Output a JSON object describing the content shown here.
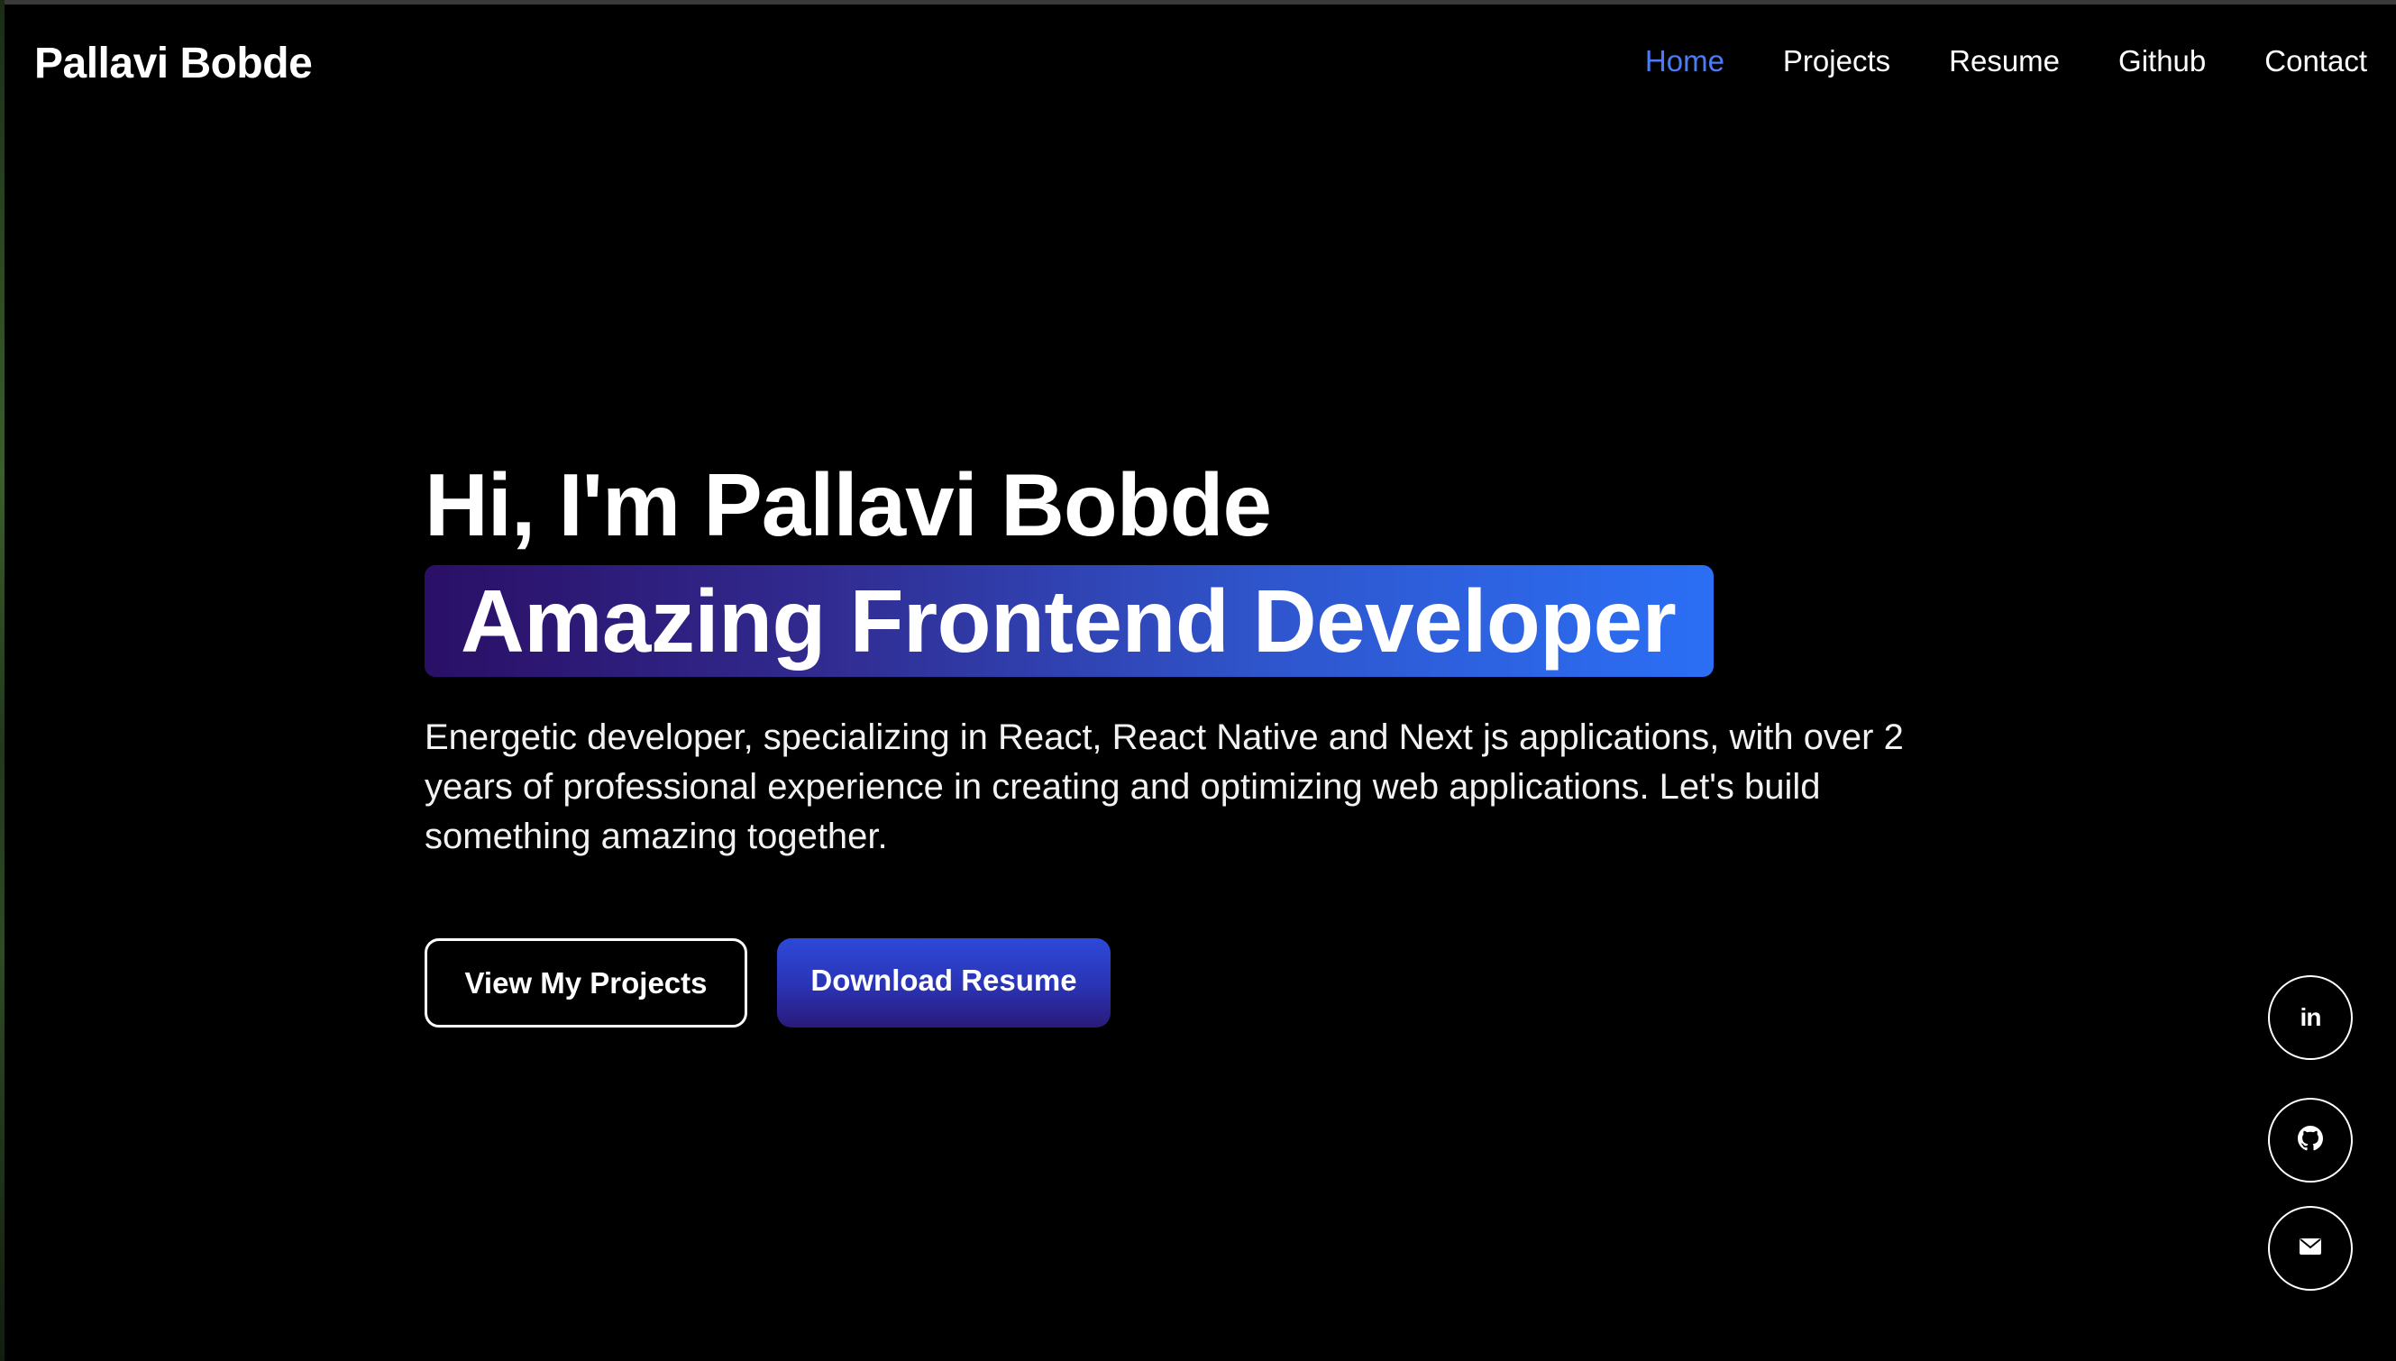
{
  "nav": {
    "brand": "Pallavi Bobde",
    "items": [
      {
        "label": "Home",
        "active": true
      },
      {
        "label": "Projects",
        "active": false
      },
      {
        "label": "Resume",
        "active": false
      },
      {
        "label": "Github",
        "active": false
      },
      {
        "label": "Contact",
        "active": false
      }
    ],
    "active_color": "#4b7bf5"
  },
  "hero": {
    "greeting": "Hi, I'm Pallavi Bobde",
    "role": "Amazing Frontend Developer",
    "description": "Energetic developer, specializing in React, React Native and Next js applications, with over 2 years of professional experience in creating and optimizing web applications. Let's build something amazing together.",
    "primary_cta": "View My Projects",
    "secondary_cta": "Download Resume"
  },
  "social": {
    "linkedin_label": "in",
    "items": [
      "linkedin-icon",
      "github-icon",
      "mail-icon"
    ]
  },
  "colors": {
    "background": "#000000",
    "text": "#ffffff",
    "accent_blue": "#2b6ff5",
    "accent_purple": "#2a0f66"
  }
}
